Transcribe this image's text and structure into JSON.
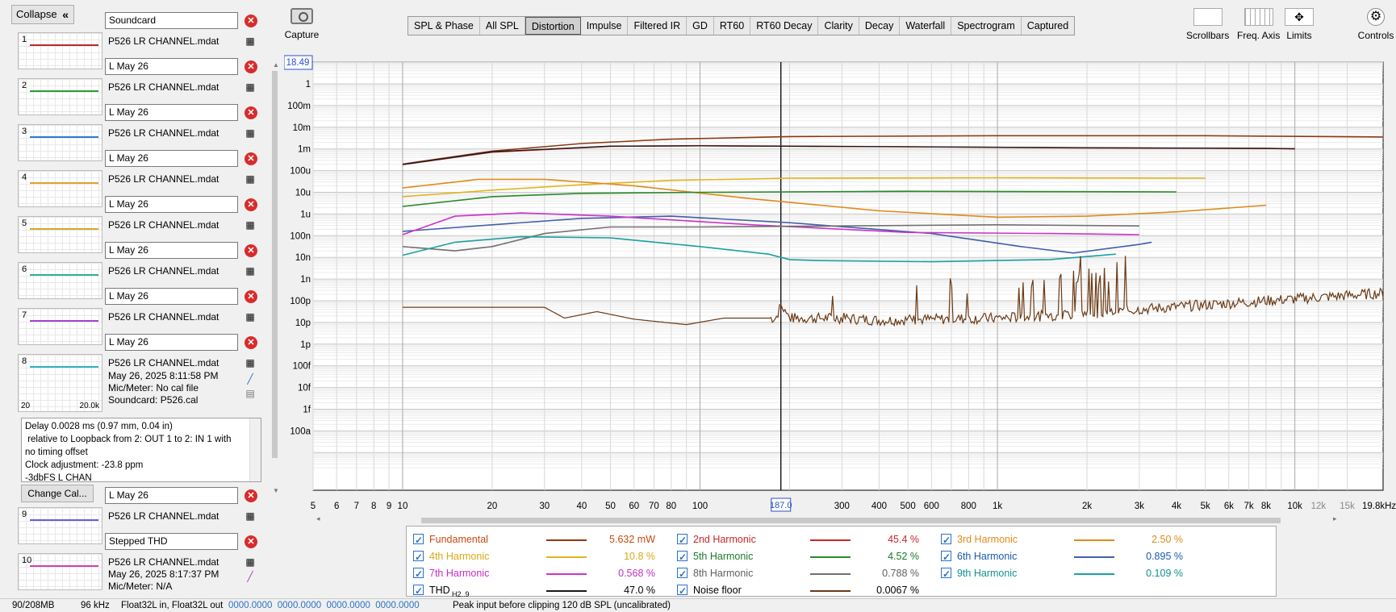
{
  "sidebar": {
    "collapse_label": "Collapse",
    "collapse_chevron": "«",
    "soundcard_name": "Soundcard",
    "measurements": [
      {
        "num": "1",
        "name": "L May 26",
        "file": "P526 LR CHANNEL.mdat",
        "color": "#c0282b"
      },
      {
        "num": "2",
        "name": "L May 26",
        "file": "P526 LR CHANNEL.mdat",
        "color": "#2e9a3a"
      },
      {
        "num": "3",
        "name": "L May 26",
        "file": "P526 LR CHANNEL.mdat",
        "color": "#2b7bd0"
      },
      {
        "num": "4",
        "name": "L May 26",
        "file": "P526 LR CHANNEL.mdat",
        "color": "#e3a02a"
      },
      {
        "num": "5",
        "name": "L May 26",
        "file": "P526 LR CHANNEL.mdat",
        "color": "#d6a630"
      },
      {
        "num": "6",
        "name": "L May 26",
        "file": "P526 LR CHANNEL.mdat",
        "color": "#30b090"
      },
      {
        "num": "7",
        "name": "L May 26",
        "file": "P526 LR CHANNEL.mdat",
        "color": "#a040d8"
      },
      {
        "num": "8",
        "name": "L May 26",
        "file": "P526 LR CHANNEL.mdat",
        "color": "#30b0c0"
      },
      {
        "num": "9",
        "name": "L May 26",
        "file": "P526 LR CHANNEL.mdat",
        "color": "#6060e0"
      },
      {
        "num": "10",
        "name": "Stepped THD",
        "file": "P526 LR CHANNEL.mdat",
        "color": "#d040b0"
      }
    ],
    "selected": {
      "date": "May 26, 2025 8:11:58 PM",
      "mic": "Mic/Meter: No cal file",
      "soundcard": "Soundcard: P526.cal",
      "thumb_left": "20",
      "thumb_right": "20.0k"
    },
    "details_lines": [
      "Delay 0.0028 ms (0.97 mm, 0.04 in)",
      " relative to Loopback from 2: OUT 1 to 2: IN 1 with",
      "no timing offset",
      "Clock adjustment: -23.8 ppm",
      "-3dbFS L CHAN"
    ],
    "change_cal_label": "Change Cal...",
    "last": {
      "date": "May 26, 2025 8:17:37 PM",
      "mic": "Mic/Meter: N/A"
    }
  },
  "toolbar": {
    "capture_label": "Capture",
    "tabs": [
      "SPL & Phase",
      "All SPL",
      "Distortion",
      "Impulse",
      "Filtered IR",
      "GD",
      "RT60",
      "RT60 Decay",
      "Clarity",
      "Decay",
      "Waterfall",
      "Spectrogram",
      "Captured"
    ],
    "active_tab": "Distortion",
    "right_tools": [
      "Scrollbars",
      "Freq. Axis",
      "Limits",
      "Controls"
    ]
  },
  "graph": {
    "y_unit": "W",
    "y_cursor_value": "18.49",
    "x_cursor_value": "187.0",
    "y_labels": [
      "1",
      "100m",
      "10m",
      "1m",
      "100u",
      "10u",
      "1u",
      "100n",
      "10n",
      "1n",
      "100p",
      "10p",
      "1p",
      "100f",
      "10f",
      "1f",
      "100a"
    ],
    "x_labels": [
      "5",
      "6",
      "7",
      "8",
      "9",
      "10",
      "20",
      "30",
      "40",
      "50",
      "60",
      "70",
      "80",
      "100",
      "300",
      "400",
      "500",
      "600",
      "800",
      "1k",
      "2k",
      "3k",
      "4k",
      "5k",
      "6k",
      "7k",
      "8k",
      "10k",
      "12k",
      "15k",
      "19.8kHz"
    ],
    "colors": {
      "fundamental": "#8b3a12",
      "h2": "#c8262c",
      "h3": "#e08a1a",
      "h4": "#e2b41c",
      "h5": "#2a8a2a",
      "h6": "#4060a8",
      "h7": "#cc33cc",
      "h8": "#707070",
      "h9": "#1aa0a0",
      "thd": "#1a1a1a",
      "noise": "#6b3a14"
    }
  },
  "legend": [
    {
      "name": "Fundamental",
      "value": "5.632 mW",
      "color": "#8b3a12"
    },
    {
      "name": "2nd Harmonic",
      "value": "45.4 %",
      "color": "#c8262c"
    },
    {
      "name": "3rd Harmonic",
      "value": "2.50 %",
      "color": "#e08a1a"
    },
    {
      "name": "4th Harmonic",
      "value": "10.8 %",
      "color": "#e2b41c"
    },
    {
      "name": "5th Harmonic",
      "value": "4.52 %",
      "color": "#2a8a2a"
    },
    {
      "name": "6th Harmonic",
      "value": "0.895 %",
      "color": "#4060a8"
    },
    {
      "name": "7th Harmonic",
      "value": "0.568 %",
      "color": "#cc33cc"
    },
    {
      "name": "8th Harmonic",
      "value": "0.788 %",
      "color": "#707070"
    },
    {
      "name": "9th Harmonic",
      "value": "0.109 %",
      "color": "#1aa0a0"
    },
    {
      "name": "THD",
      "sub": "H2..9",
      "value": "47.0 %",
      "color": "#1a1a1a"
    },
    {
      "name": "Noise floor",
      "value": "0.0067 %",
      "color": "#6b3a14"
    }
  ],
  "status": {
    "memory": "90/208MB",
    "rate": "96 kHz",
    "format": "Float32L in, Float32L out",
    "levels": "0000.0000  0000.0000  0000.0000  0000.0000",
    "peak": "Peak input before clipping 120 dB SPL (uncalibrated)"
  }
}
